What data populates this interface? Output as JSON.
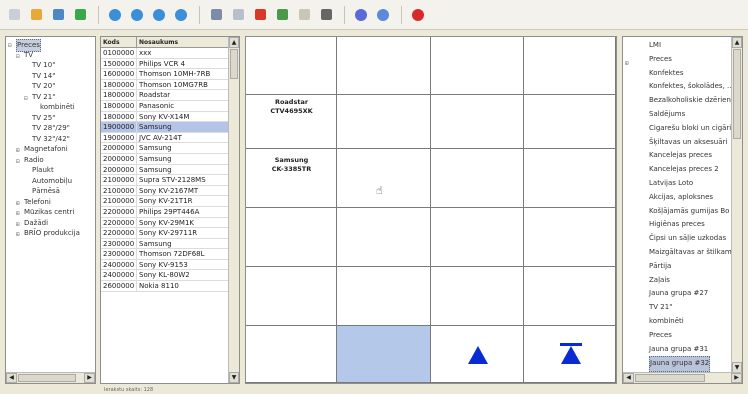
{
  "toolbar": {
    "buttons": [
      {
        "icon": "new-icon",
        "color": "#c8cfd8"
      },
      {
        "icon": "open-folder-icon",
        "color": "#e8a83a"
      },
      {
        "icon": "save-icon",
        "color": "#4f86c6"
      },
      {
        "icon": "refresh-icon",
        "color": "#3aa84a"
      },
      {
        "icon": "globe-icon-1",
        "color": "#3b8fd9"
      },
      {
        "icon": "globe-icon-2",
        "color": "#3b8fd9"
      },
      {
        "icon": "globe-icon-3",
        "color": "#3b8fd9"
      },
      {
        "icon": "globe-icon-4",
        "color": "#3b8fd9"
      },
      {
        "icon": "monitor-icon",
        "color": "#7a8ca8"
      },
      {
        "icon": "document-icon",
        "color": "#b8bfcc"
      },
      {
        "icon": "delete-icon",
        "color": "#d83a2a"
      },
      {
        "icon": "tree-icon",
        "color": "#4a9a4a"
      },
      {
        "icon": "filter-icon",
        "color": "#c9c6b8"
      },
      {
        "icon": "columns-icon",
        "color": "#666666"
      },
      {
        "icon": "info-icon",
        "color": "#5a6ad9"
      },
      {
        "icon": "help-icon",
        "color": "#5a8ad9"
      },
      {
        "icon": "stop-icon",
        "color": "#d82a2a"
      }
    ]
  },
  "left_tree": {
    "items": [
      {
        "label": "Preces",
        "level": 0,
        "expander": "⊟",
        "selected": true
      },
      {
        "label": "TV",
        "level": 1,
        "expander": "⊟"
      },
      {
        "label": "TV 10\"",
        "level": 2,
        "expander": ""
      },
      {
        "label": "TV 14\"",
        "level": 2,
        "expander": ""
      },
      {
        "label": "TV 20\"",
        "level": 2,
        "expander": ""
      },
      {
        "label": "TV 21\"",
        "level": 2,
        "expander": "⊟"
      },
      {
        "label": "kombinēti",
        "level": 3,
        "expander": ""
      },
      {
        "label": "TV 25\"",
        "level": 2,
        "expander": ""
      },
      {
        "label": "TV 28\"/29\"",
        "level": 2,
        "expander": ""
      },
      {
        "label": "TV 32\"/42\"",
        "level": 2,
        "expander": ""
      },
      {
        "label": "Magnetafoni",
        "level": 1,
        "expander": "⊞"
      },
      {
        "label": "Radio",
        "level": 1,
        "expander": "⊟"
      },
      {
        "label": "Plaukt",
        "level": 2,
        "expander": ""
      },
      {
        "label": "Automobiļu",
        "level": 2,
        "expander": ""
      },
      {
        "label": "Pārnēsā",
        "level": 2,
        "expander": ""
      },
      {
        "label": "Telefoni",
        "level": 1,
        "expander": "⊞"
      },
      {
        "label": "Mūzikas centri",
        "level": 1,
        "expander": "⊞"
      },
      {
        "label": "Dažādi",
        "level": 1,
        "expander": "⊞"
      },
      {
        "label": "BRĪO produkcija",
        "level": 1,
        "expander": "⊞"
      }
    ]
  },
  "list": {
    "headers": [
      "Kods",
      "Nosaukums"
    ],
    "rows": [
      [
        "0100000",
        "xxx"
      ],
      [
        "1500000",
        "Philips VCR 4"
      ],
      [
        "1600000",
        "Thomson 10MH-7RB"
      ],
      [
        "1800000",
        "Thomson 10MG7RB"
      ],
      [
        "1800000",
        "Roadstar"
      ],
      [
        "1800000",
        "Panasonic"
      ],
      [
        "1800000",
        "Sony KV-X14M"
      ],
      [
        "1900000",
        "Samsung"
      ],
      [
        "1900000",
        "JVC AV-214T"
      ],
      [
        "2000000",
        "Samsung"
      ],
      [
        "2000000",
        "Samsung"
      ],
      [
        "2000000",
        "Samsung"
      ],
      [
        "2100000",
        "Supra STV-2128MS"
      ],
      [
        "2100000",
        "Sony KV-2167MT"
      ],
      [
        "2100000",
        "Sony KV-21T1R"
      ],
      [
        "2200000",
        "Philips 29PT446A"
      ],
      [
        "2200000",
        "Sony KV-29M1K"
      ],
      [
        "2200000",
        "Sony KV-29711R"
      ],
      [
        "2300000",
        "Samsung"
      ],
      [
        "2300000",
        "Thomson 72DF68L"
      ],
      [
        "2400000",
        "Sony KV-9153"
      ],
      [
        "2400000",
        "Sony KL-80W2"
      ],
      [
        "2600000",
        "Nokia 8110"
      ]
    ],
    "selected_index": 7
  },
  "grid": {
    "labels": [
      {
        "line1": "Roadstar",
        "line2": "CTV4695XK"
      },
      {
        "line1": "Samsung",
        "line2": "CK-3385TR"
      }
    ],
    "highlight_color": "#b4c8ea",
    "marker_color": "#0a2bd4"
  },
  "right_tree": {
    "items": [
      {
        "label": "LMI",
        "expander": ""
      },
      {
        "label": "Preces",
        "expander": "⊞"
      },
      {
        "label": "Konfektes",
        "expander": ""
      },
      {
        "label": "Konfektes, šokolādes, ...",
        "expander": ""
      },
      {
        "label": "Bezalkoholiskie dzērieni",
        "expander": ""
      },
      {
        "label": "Saldējums",
        "expander": ""
      },
      {
        "label": "Cigarešu bloki un cigāri",
        "expander": ""
      },
      {
        "label": "Šķiltavas un aksesuāri",
        "expander": ""
      },
      {
        "label": "Kancelejas preces",
        "expander": ""
      },
      {
        "label": "Kancelejas preces 2",
        "expander": ""
      },
      {
        "label": "Latvijas Loto",
        "expander": ""
      },
      {
        "label": "Akcijas, aploksnes",
        "expander": ""
      },
      {
        "label": "Košļājamās gumijas Bo",
        "expander": ""
      },
      {
        "label": "Higiēnas preces",
        "expander": ""
      },
      {
        "label": "Čipsi un sāļie uzkodas",
        "expander": ""
      },
      {
        "label": "Maizgāltavas ar štilkami",
        "expander": ""
      },
      {
        "label": "Pārtija",
        "expander": ""
      },
      {
        "label": "Zaļais",
        "expander": ""
      },
      {
        "label": "Jauna grupa #27",
        "expander": ""
      },
      {
        "label": "TV 21\"",
        "expander": ""
      },
      {
        "label": "kombinēti",
        "expander": ""
      },
      {
        "label": "Preces",
        "expander": ""
      },
      {
        "label": "Jauna grupa #31",
        "expander": ""
      },
      {
        "label": "Jauna grupa #32",
        "expander": "",
        "selected": true
      }
    ]
  },
  "status": {
    "text": "Ierakstu skaits: 128"
  }
}
